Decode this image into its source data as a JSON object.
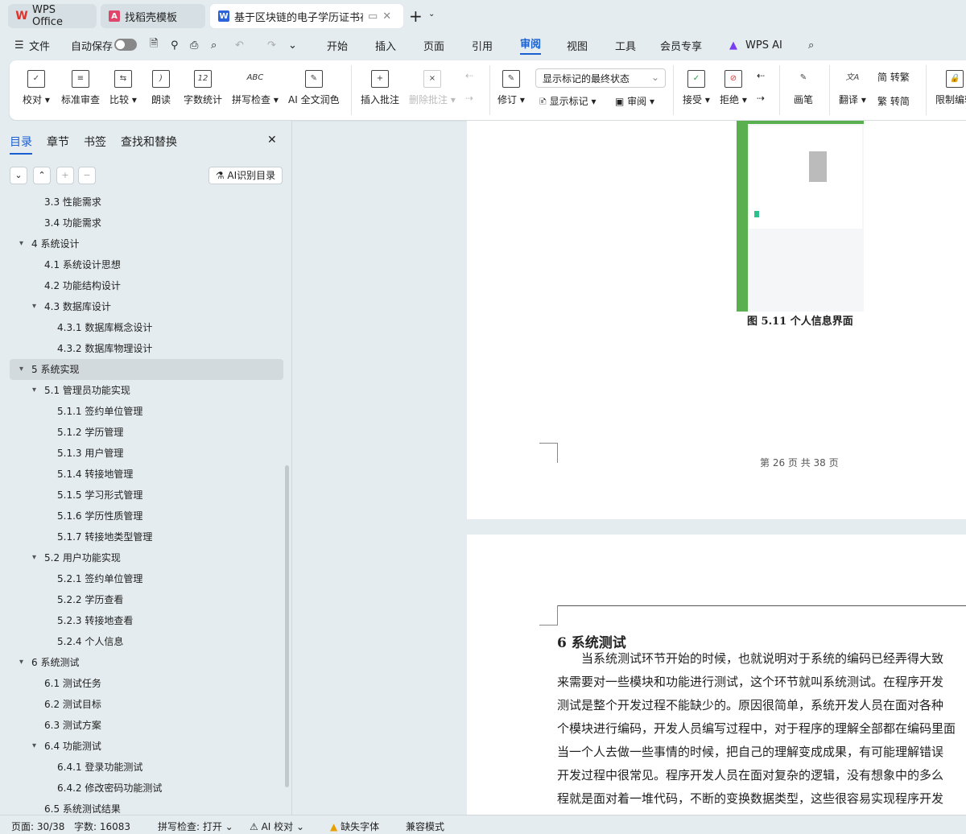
{
  "tabs": [
    {
      "label": "WPS Office"
    },
    {
      "label": "找稻壳模板"
    },
    {
      "label": "基于区块链的电子学历证书存"
    }
  ],
  "menu": {
    "file": "文件",
    "autosave": "自动保存",
    "items": [
      "开始",
      "插入",
      "页面",
      "引用",
      "审阅",
      "视图",
      "工具",
      "会员专享"
    ],
    "ai": "WPS AI",
    "active": "审阅"
  },
  "ribbon": {
    "proof": "校对",
    "standard": "标准审查",
    "compare": "比较",
    "read": "朗读",
    "wordcount": "字数统计",
    "spell": "拼写检查",
    "ai_polish": "AI 全文润色",
    "insert_comment": "插入批注",
    "delete_comment": "删除批注",
    "track": "修订",
    "markup_select": "显示标记的最终状态",
    "show_markup": "显示标记",
    "review": "审阅",
    "accept": "接受",
    "reject": "拒绝",
    "pen": "画笔",
    "translate": "翻译",
    "to_trad": "转繁",
    "to_simp": "转简",
    "restrict": "限制编辑"
  },
  "sidebar": {
    "tabs": [
      "目录",
      "章节",
      "书签",
      "查找和替换"
    ],
    "ai_toc": "AI识别目录",
    "toc": [
      {
        "label": "3.3  性能需求",
        "level": 2
      },
      {
        "label": "3.4  功能需求",
        "level": 2
      },
      {
        "label": "4  系统设计",
        "level": 1,
        "expanded": true
      },
      {
        "label": "4.1  系统设计思想",
        "level": 2
      },
      {
        "label": "4.2  功能结构设计",
        "level": 2
      },
      {
        "label": "4.3  数据库设计",
        "level": 2,
        "expanded": true
      },
      {
        "label": "4.3.1  数据库概念设计",
        "level": 3
      },
      {
        "label": "4.3.2  数据库物理设计",
        "level": 3
      },
      {
        "label": "5  系统实现",
        "level": 1,
        "expanded": true,
        "selected": true
      },
      {
        "label": "5.1  管理员功能实现",
        "level": 2,
        "expanded": true
      },
      {
        "label": "5.1.1  签约单位管理",
        "level": 3
      },
      {
        "label": "5.1.2  学历管理",
        "level": 3
      },
      {
        "label": "5.1.3  用户管理",
        "level": 3
      },
      {
        "label": "5.1.4  转接地管理",
        "level": 3
      },
      {
        "label": "5.1.5  学习形式管理",
        "level": 3
      },
      {
        "label": "5.1.6  学历性质管理",
        "level": 3
      },
      {
        "label": "5.1.7  转接地类型管理",
        "level": 3
      },
      {
        "label": "5.2  用户功能实现",
        "level": 2,
        "expanded": true
      },
      {
        "label": "5.2.1  签约单位管理",
        "level": 3
      },
      {
        "label": "5.2.2  学历查看",
        "level": 3
      },
      {
        "label": "5.2.3  转接地查看",
        "level": 3
      },
      {
        "label": "5.2.4  个人信息",
        "level": 3
      },
      {
        "label": "6  系统测试",
        "level": 1,
        "expanded": true
      },
      {
        "label": "6.1  测试任务",
        "level": 2
      },
      {
        "label": "6.2  测试目标",
        "level": 2
      },
      {
        "label": "6.3  测试方案",
        "level": 2
      },
      {
        "label": "6.4  功能测试",
        "level": 2,
        "expanded": true
      },
      {
        "label": "6.4.1  登录功能测试",
        "level": 3
      },
      {
        "label": "6.4.2  修改密码功能测试",
        "level": 3
      },
      {
        "label": "6.5  系统测试结果",
        "level": 2
      }
    ]
  },
  "document": {
    "figure_caption": "图 5.11  个人信息界面",
    "page_footer": "第 26 页 共 38 页",
    "heading": "6  系统测试",
    "paragraph": [
      "　　当系统测试环节开始的时候，也就说明对于系统的编码已经弄得大致",
      "来需要对一些模块和功能进行测试，这个环节就叫系统测试。在程序开发",
      "测试是整个开发过程不能缺少的。原因很简单，系统开发人员在面对各种",
      "个模块进行编码，开发人员编写过程中，对于程序的理解全部都在编码里面",
      "当一个人去做一些事情的时候，把自己的理解变成成果，有可能理解错误",
      "开发过程中很常见。程序开发人员在面对复杂的逻辑，没有想象中的多么",
      "程就是面对着一堆代码，不断的变换数据类型，这些很容易实现程序开发"
    ]
  },
  "status": {
    "page": "页面: 30/38",
    "words": "字数: 16083",
    "spell": "拼写检查: 打开",
    "ai_proof": "AI 校对",
    "missing_font": "缺失字体",
    "compat": "兼容模式"
  },
  "colors": {
    "accent": "#1a5fd0",
    "screenshot_green": "#5aaf4f"
  }
}
